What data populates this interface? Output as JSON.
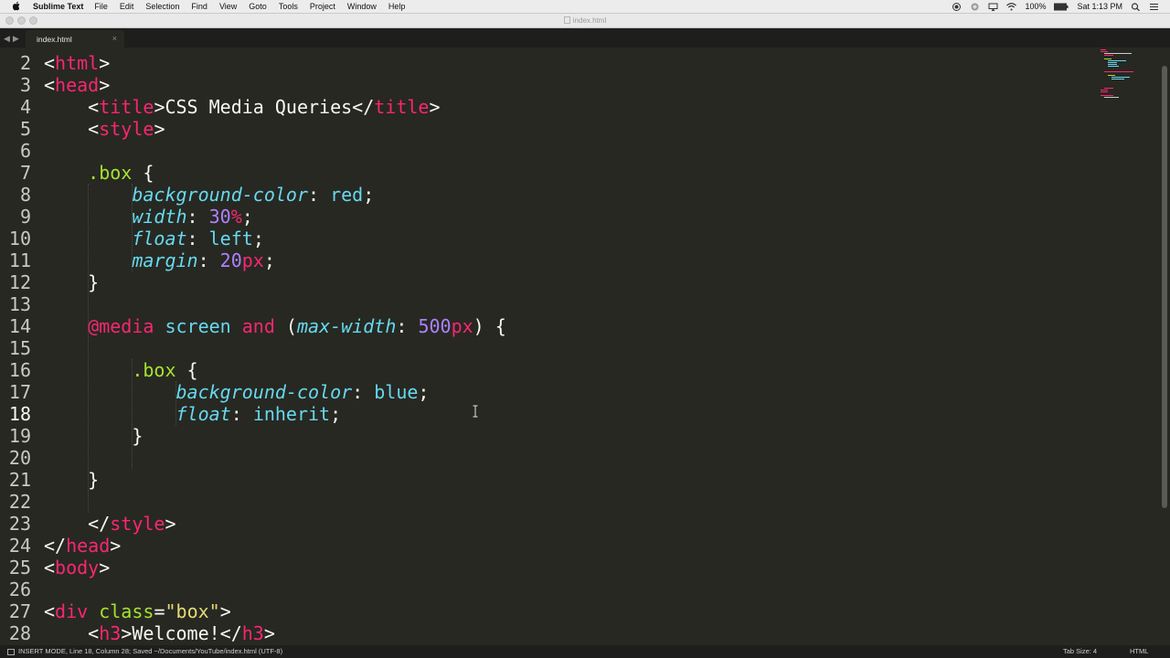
{
  "menubar": {
    "apple_icon": "apple-logo",
    "app_name": "Sublime Text",
    "items": [
      "File",
      "Edit",
      "Selection",
      "Find",
      "View",
      "Goto",
      "Tools",
      "Project",
      "Window",
      "Help"
    ],
    "battery": "100%",
    "clock": "Sat 1:13 PM"
  },
  "window": {
    "title": "index.html"
  },
  "tabs": [
    {
      "label": "index.html",
      "close": "×"
    }
  ],
  "editor": {
    "active_line": 18,
    "lines": [
      {
        "n": "2",
        "text": "<html>"
      },
      {
        "n": "3",
        "text": "<head>"
      },
      {
        "n": "4",
        "text": "    <title>CSS Media Queries</title>"
      },
      {
        "n": "5",
        "text": "    <style>"
      },
      {
        "n": "6",
        "text": ""
      },
      {
        "n": "7",
        "text": "    .box {"
      },
      {
        "n": "8",
        "text": "        background-color: red;"
      },
      {
        "n": "9",
        "text": "        width: 30%;"
      },
      {
        "n": "10",
        "text": "        float: left;"
      },
      {
        "n": "11",
        "text": "        margin: 20px;"
      },
      {
        "n": "12",
        "text": "    }"
      },
      {
        "n": "13",
        "text": ""
      },
      {
        "n": "14",
        "text": "    @media screen and (max-width: 500px) {"
      },
      {
        "n": "15",
        "text": ""
      },
      {
        "n": "16",
        "text": "        .box {"
      },
      {
        "n": "17",
        "text": "            background-color: blue;"
      },
      {
        "n": "18",
        "text": "            float: inherit;"
      },
      {
        "n": "19",
        "text": "        }"
      },
      {
        "n": "20",
        "text": ""
      },
      {
        "n": "21",
        "text": "    }"
      },
      {
        "n": "22",
        "text": ""
      },
      {
        "n": "23",
        "text": "    </style>"
      },
      {
        "n": "24",
        "text": "</head>"
      },
      {
        "n": "25",
        "text": "<body>"
      },
      {
        "n": "26",
        "text": ""
      },
      {
        "n": "27",
        "text": "<div class=\"box\">"
      },
      {
        "n": "28",
        "text": "    <h3>Welcome!</h3>"
      }
    ]
  },
  "statusbar": {
    "left": "INSERT MODE, Line 18, Column 28; Saved ~/Documents/YouTube/index.html (UTF-8)",
    "tab_size": "Tab Size: 4",
    "syntax": "HTML"
  },
  "colors": {
    "background": "#272822",
    "tag": "#f92672",
    "entity": "#a6e22e",
    "property": "#66d9ef",
    "number": "#ae81ff",
    "string": "#e6db74"
  }
}
